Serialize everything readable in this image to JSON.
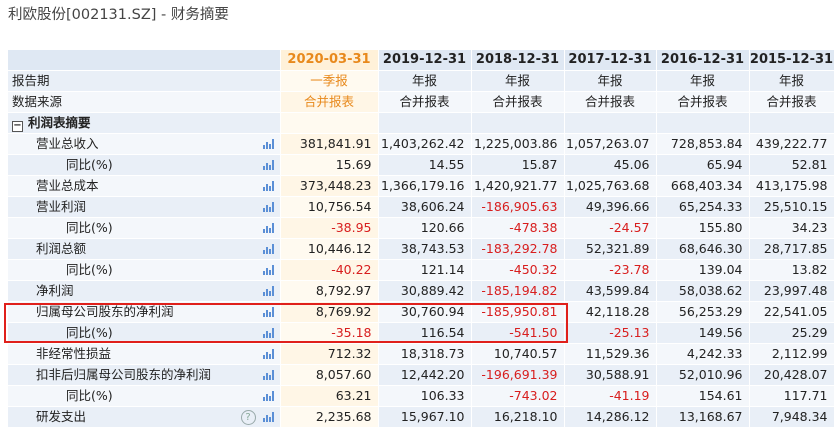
{
  "page_title": "利欧股份[002131.SZ] - 财务摘要",
  "columns": [
    "2020-03-31",
    "2019-12-31",
    "2018-12-31",
    "2017-12-31",
    "2016-12-31",
    "2015-12-31"
  ],
  "colors": {
    "accent_orange": "#e8891c",
    "negative_red": "#d81e1e",
    "highlight_border": "#e0201b",
    "header_bg": "#dfe8f3"
  },
  "meta_rows": [
    {
      "label": "报告期",
      "values": [
        "一季报",
        "年报",
        "年报",
        "年报",
        "年报",
        "年报"
      ]
    },
    {
      "label": "数据来源",
      "values": [
        "合并报表",
        "合并报表",
        "合并报表",
        "合并报表",
        "合并报表",
        "合并报表"
      ]
    }
  ],
  "section": {
    "label": "利润表摘要",
    "toggle": "−"
  },
  "rows": [
    {
      "label": "营业总收入",
      "indent": 1,
      "values": [
        "381,841.91",
        "1,403,262.42",
        "1,225,003.86",
        "1,057,263.07",
        "728,853.84",
        "439,222.77"
      ],
      "icon": "bar-chart-icon"
    },
    {
      "label": "同比(%)",
      "indent": 2,
      "values": [
        "15.69",
        "14.55",
        "15.87",
        "45.06",
        "65.94",
        "52.81"
      ],
      "icon": "bar-chart-icon"
    },
    {
      "label": "营业总成本",
      "indent": 1,
      "values": [
        "373,448.23",
        "1,366,179.16",
        "1,420,921.77",
        "1,025,763.68",
        "668,403.34",
        "413,175.98"
      ],
      "icon": "bar-chart-icon"
    },
    {
      "label": "营业利润",
      "indent": 1,
      "values": [
        "10,756.54",
        "38,606.24",
        "-186,905.63",
        "49,396.66",
        "65,254.33",
        "25,510.15"
      ],
      "icon": "bar-chart-icon"
    },
    {
      "label": "同比(%)",
      "indent": 2,
      "values": [
        "-38.95",
        "120.66",
        "-478.38",
        "-24.57",
        "155.80",
        "34.23"
      ],
      "icon": "bar-chart-icon"
    },
    {
      "label": "利润总额",
      "indent": 1,
      "values": [
        "10,446.12",
        "38,743.53",
        "-183,292.78",
        "52,321.89",
        "68,646.30",
        "28,717.85"
      ],
      "icon": "bar-chart-icon"
    },
    {
      "label": "同比(%)",
      "indent": 2,
      "values": [
        "-40.22",
        "121.14",
        "-450.32",
        "-23.78",
        "139.04",
        "13.82"
      ],
      "icon": "bar-chart-icon"
    },
    {
      "label": "净利润",
      "indent": 1,
      "values": [
        "8,792.97",
        "30,889.42",
        "-185,194.82",
        "43,599.84",
        "58,038.62",
        "23,997.48"
      ],
      "icon": "bar-chart-icon"
    },
    {
      "label": "归属母公司股东的净利润",
      "indent": 1,
      "values": [
        "8,769.92",
        "30,760.94",
        "-185,950.81",
        "42,118.28",
        "56,253.29",
        "22,541.05"
      ],
      "icon": "bar-chart-icon"
    },
    {
      "label": "同比(%)",
      "indent": 2,
      "values": [
        "-35.18",
        "116.54",
        "-541.50",
        "-25.13",
        "149.56",
        "25.29"
      ],
      "icon": "bar-chart-icon"
    },
    {
      "label": "非经常性损益",
      "indent": 1,
      "values": [
        "712.32",
        "18,318.73",
        "10,740.57",
        "11,529.36",
        "4,242.33",
        "2,112.99"
      ],
      "icon": "bar-chart-icon"
    },
    {
      "label": "扣非后归属母公司股东的净利润",
      "indent": 1,
      "values": [
        "8,057.60",
        "12,442.20",
        "-196,691.39",
        "30,588.91",
        "52,010.96",
        "20,428.07"
      ],
      "icon": "bar-chart-icon"
    },
    {
      "label": "同比(%)",
      "indent": 2,
      "values": [
        "63.21",
        "106.33",
        "-743.02",
        "-41.19",
        "154.61",
        "117.71"
      ],
      "icon": "bar-chart-icon"
    },
    {
      "label": "研发支出",
      "indent": 1,
      "values": [
        "2,235.68",
        "15,967.10",
        "16,218.10",
        "14,286.12",
        "13,168.67",
        "7,948.34"
      ],
      "icon": "bar-chart-icon",
      "help": "?"
    }
  ]
}
